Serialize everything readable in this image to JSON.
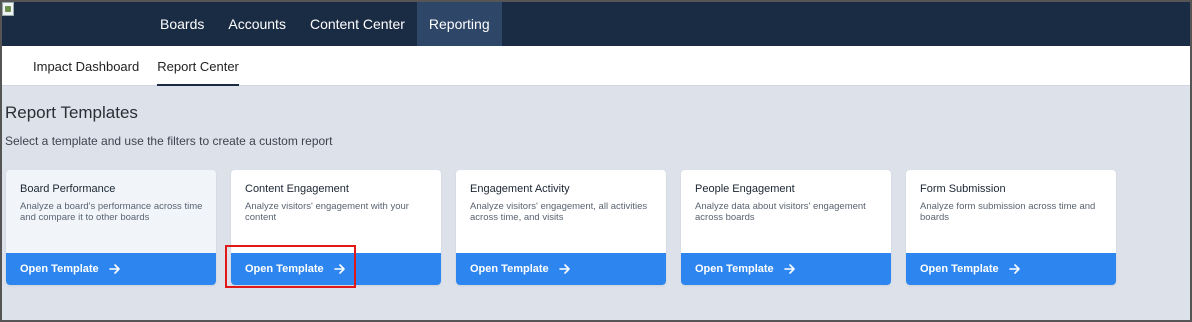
{
  "topnav": {
    "items": [
      {
        "label": "Boards"
      },
      {
        "label": "Accounts"
      },
      {
        "label": "Content Center"
      },
      {
        "label": "Reporting"
      }
    ]
  },
  "subnav": {
    "items": [
      {
        "label": "Impact Dashboard"
      },
      {
        "label": "Report Center"
      }
    ]
  },
  "main": {
    "title": "Report Templates",
    "subtitle": "Select a template and use the filters to create a custom report",
    "cards": [
      {
        "title": "Board Performance",
        "description": "Analyze a board's performance across time and compare it to other boards",
        "button": "Open Template"
      },
      {
        "title": "Content Engagement",
        "description": "Analyze visitors' engagement with your content",
        "button": "Open Template"
      },
      {
        "title": "Engagement Activity",
        "description": "Analyze visitors' engagement, all activities across time, and visits",
        "button": "Open Template"
      },
      {
        "title": "People Engagement",
        "description": "Analyze data about visitors' engagement across boards",
        "button": "Open Template"
      },
      {
        "title": "Form Submission",
        "description": "Analyze form submission across time and boards",
        "button": "Open Template"
      }
    ]
  },
  "colors": {
    "topnav_bg": "#1a2b44",
    "active_nav_bg": "#2e4668",
    "button_blue": "#2d86f0",
    "highlight_red": "#e01818",
    "page_bg": "#dde2ea"
  }
}
